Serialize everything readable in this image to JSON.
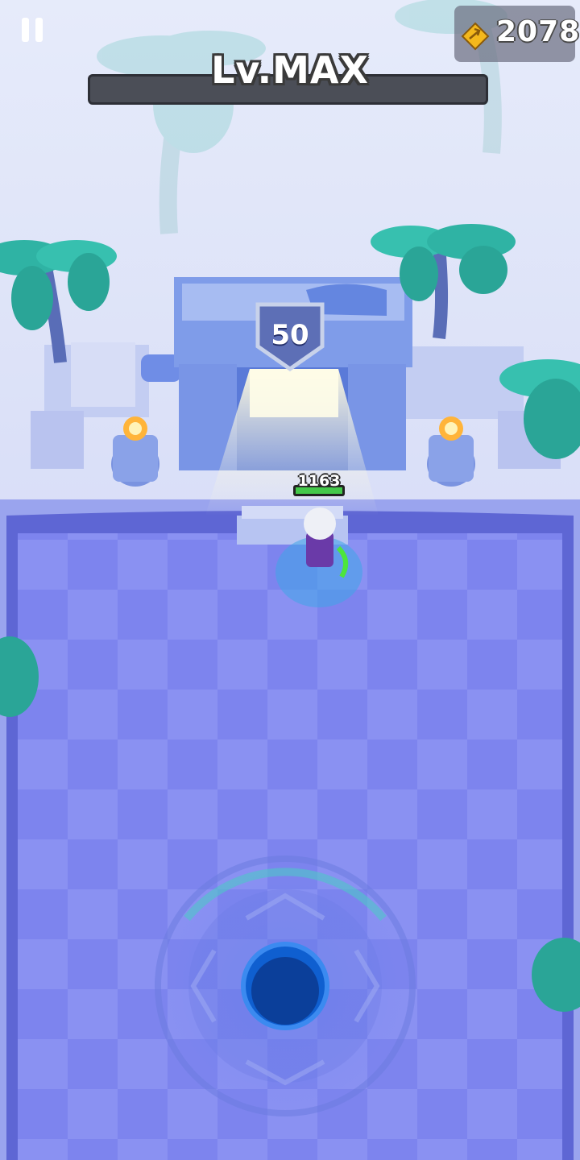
{
  "hud": {
    "pause_icon": "pause-icon",
    "gold_icon": "bow-gem-icon",
    "gold_amount": "2078",
    "level_label": "Lv.MAX"
  },
  "stage": {
    "gate_number": "50",
    "player_hp": "1163"
  },
  "colors": {
    "floor": "#7b82ee",
    "floor_tile_alt": "#8890f2",
    "wall": "#8fa0e8",
    "palm": "#34b6a8",
    "hp_green": "#44c84a",
    "joystick": "#1b66d6"
  }
}
